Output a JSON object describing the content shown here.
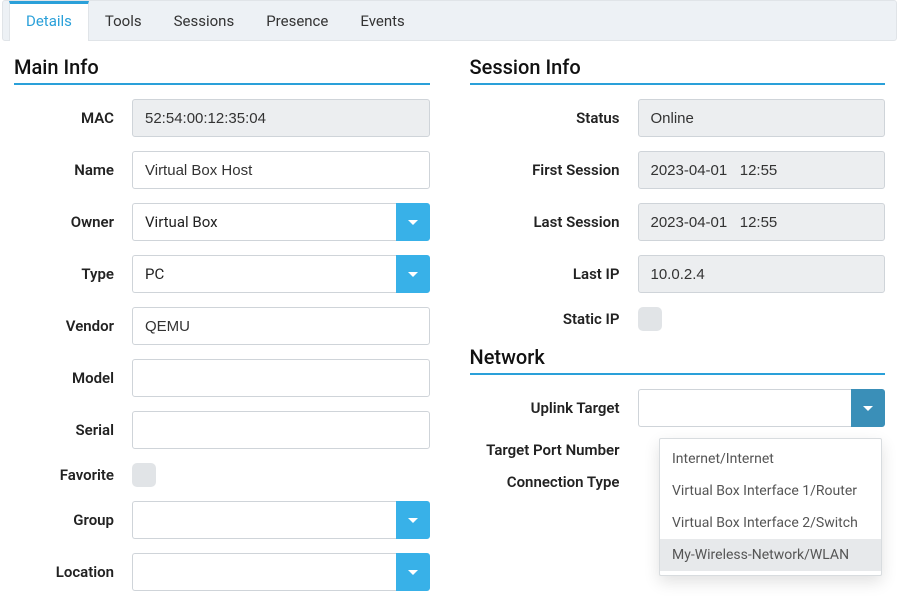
{
  "tabs": [
    {
      "label": "Details",
      "active": true
    },
    {
      "label": "Tools",
      "active": false
    },
    {
      "label": "Sessions",
      "active": false
    },
    {
      "label": "Presence",
      "active": false
    },
    {
      "label": "Events",
      "active": false
    }
  ],
  "main_info": {
    "title": "Main Info",
    "mac": {
      "label": "MAC",
      "value": "52:54:00:12:35:04"
    },
    "name": {
      "label": "Name",
      "value": "Virtual Box Host"
    },
    "owner": {
      "label": "Owner",
      "value": "Virtual Box"
    },
    "type": {
      "label": "Type",
      "value": "PC"
    },
    "vendor": {
      "label": "Vendor",
      "value": "QEMU"
    },
    "model": {
      "label": "Model",
      "value": ""
    },
    "serial": {
      "label": "Serial",
      "value": ""
    },
    "favorite": {
      "label": "Favorite",
      "checked": false
    },
    "group": {
      "label": "Group",
      "value": ""
    },
    "location": {
      "label": "Location",
      "value": ""
    }
  },
  "session_info": {
    "title": "Session Info",
    "status": {
      "label": "Status",
      "value": "Online"
    },
    "first_session": {
      "label": "First Session",
      "value": "2023-04-01   12:55"
    },
    "last_session": {
      "label": "Last Session",
      "value": "2023-04-01   12:55"
    },
    "last_ip": {
      "label": "Last IP",
      "value": "10.0.2.4"
    },
    "static_ip": {
      "label": "Static IP",
      "checked": false
    }
  },
  "network": {
    "title": "Network",
    "uplink_target": {
      "label": "Uplink Target",
      "value": ""
    },
    "target_port_number": {
      "label": "Target Port Number"
    },
    "connection_type": {
      "label": "Connection Type"
    },
    "uplink_options": [
      "Internet/Internet",
      "Virtual Box Interface 1/Router",
      "Virtual Box Interface 2/Switch",
      "My-Wireless-Network/WLAN"
    ],
    "hovered_option_index": 3
  }
}
